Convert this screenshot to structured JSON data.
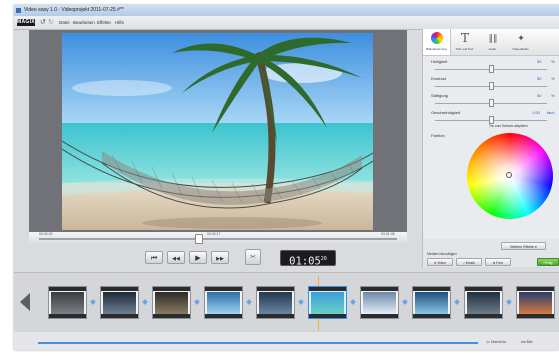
{
  "window": {
    "title": "Video easy 1.0 - Videoprojekt 2011-07-25 #**"
  },
  "toolbar": {
    "logo": "MAGIX",
    "undo_icon": "undo-icon",
    "redo_icon": "redo-icon"
  },
  "menu": [
    "Datei",
    "Bearbeiten",
    "Effekte",
    "Hilfe"
  ],
  "preview": {
    "scrub_start_label": "00:00:00",
    "scrub_position_label": "00:00:17",
    "scrub_end_label": "00:01:05",
    "scrub_progress": 0.45
  },
  "transport": {
    "buttons": [
      "jump-start",
      "rewind",
      "play",
      "fast-forward"
    ],
    "start_icon": "⏮",
    "rewind_icon": "◀◀",
    "play_icon": "▶",
    "forward_icon": "▶▶",
    "cut_icon": "scissors-icon",
    "timecode": "01:05",
    "timecode_frames": "20"
  },
  "right_panel": {
    "tabs": [
      {
        "label": "Bildoptimierung",
        "icon": "palette-icon"
      },
      {
        "label": "Titel und Text",
        "icon": "text-icon"
      },
      {
        "label": "Audio",
        "icon": "audio-icon"
      },
      {
        "label": "Videoeffekte",
        "icon": "effects-icon"
      }
    ],
    "sliders": [
      {
        "label": "Helligkeit",
        "value": "50",
        "unit": "%",
        "position": 0.5
      },
      {
        "label": "Kontrast",
        "value": "50",
        "unit": "%",
        "position": 0.5
      },
      {
        "label": "Sättigung",
        "value": "50",
        "unit": "%",
        "position": 0.5
      },
      {
        "label": "Geschwindigkeit",
        "value": "1,00",
        "unit": "fach",
        "position": 0.5
      }
    ],
    "speed_checkbox_label": "Ton zum Schluss abspielen",
    "color_label": "Farbton",
    "mehr_button": "Weitere Effekte ▾",
    "media_label": "Medien hinzufügen",
    "add_buttons": [
      "Video",
      "Musik",
      "Foto"
    ],
    "finish_button": "Fertig"
  },
  "timeline": {
    "clip_count": 10,
    "active_clip": 5
  },
  "statusbar": {
    "left_label": "",
    "right_labels": [
      "1× Übersicht",
      "Ins Bild"
    ]
  }
}
